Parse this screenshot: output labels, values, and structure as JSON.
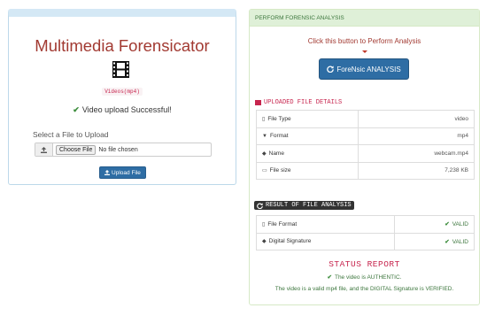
{
  "upload_panel": {
    "title": "Multimedia Forensicator",
    "format_code": "Videos(mp4)",
    "success_message": "Video upload Successful!",
    "select_label": "Select a File to Upload",
    "choose_file_label": "Choose File",
    "no_file_text": "No file chosen",
    "upload_button": "Upload File"
  },
  "analysis_panel": {
    "header": "PERFORM FORENSIC ANALYSIS",
    "prompt": "Click this button to Perform Analysis",
    "analysis_button": "ForeNsic ANALYSIS",
    "uploaded_title": "UPLOADED FILE DETAILS",
    "file_details": [
      {
        "icon": "file-icon",
        "label": "File Type",
        "value": "video"
      },
      {
        "icon": "filter-icon",
        "label": "Format",
        "value": "mp4"
      },
      {
        "icon": "tag-icon",
        "label": "Name",
        "value": "webcam.mp4"
      },
      {
        "icon": "harddisk-icon",
        "label": "File size",
        "value": "7,238 KB"
      }
    ],
    "result_title": "RESULT OF FILE ANALYSIS",
    "results": [
      {
        "icon": "file-icon",
        "label": "File Format",
        "value": "VALID"
      },
      {
        "icon": "tag-icon",
        "label": "Digital Signature",
        "value": "VALID"
      }
    ],
    "status_title": "STATUS REPORT",
    "status_line1": "The video is AUTHENTIC.",
    "status_line2": "The video is a valid mp4 file, and the DIGITAL Signature is VERIFIED."
  },
  "colors": {
    "title_red": "#a23a32",
    "primary_blue": "#2e6da4",
    "success_green": "#3c763d",
    "code_pink": "#c7254e"
  }
}
